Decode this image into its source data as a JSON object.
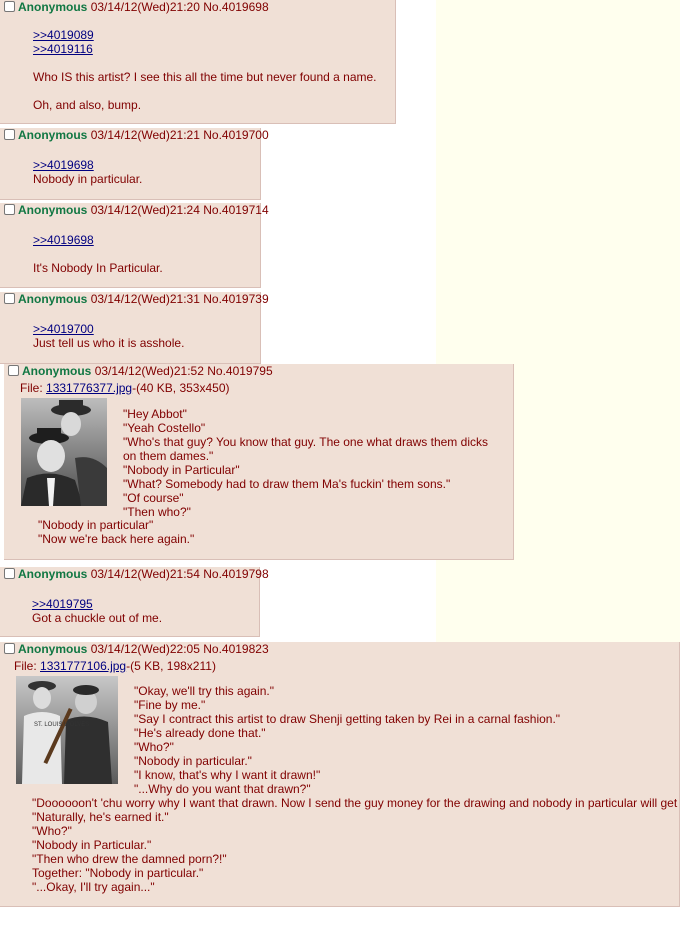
{
  "posts": [
    {
      "name": "Anonymous",
      "datetime": "03/14/12(Wed)21:20",
      "no": "No.4019698",
      "lines": [
        ">>4019089",
        ">>4019116",
        "",
        "Who IS this artist? I see this all the time but never found a name.",
        "",
        "Oh, and also, bump."
      ]
    },
    {
      "name": "Anonymous",
      "datetime": "03/14/12(Wed)21:21",
      "no": "No.4019700",
      "lines": [
        ">>4019698",
        "Nobody in particular."
      ]
    },
    {
      "name": "Anonymous",
      "datetime": "03/14/12(Wed)21:24",
      "no": "No.4019714",
      "lines": [
        ">>4019698",
        "",
        "It's Nobody In Particular."
      ]
    },
    {
      "name": "Anonymous",
      "datetime": "03/14/12(Wed)21:31",
      "no": "No.4019739",
      "lines": [
        ">>4019700",
        "Just tell us who it is asshole."
      ]
    },
    {
      "name": "Anonymous",
      "datetime": "03/14/12(Wed)21:52",
      "no": "No.4019795",
      "file_prefix": "File: ",
      "file_name": "1331776377.jpg",
      "file_meta": "-(40 KB, 353x450)",
      "lines": [
        "\"Hey Abbot\"",
        "\"Yeah Costello\"",
        "\"Who's that guy? You know that guy. The one what draws them dicks",
        "on them dames.\"",
        "\"Nobody in Particular\"",
        "\"What? Somebody had to draw them Ma's fuckin' them sons.\"",
        "\"Of course\"",
        "\"Then who?\""
      ],
      "lines_below": [
        "\"Nobody in particular\"",
        "\"Now we're back here again.\""
      ]
    },
    {
      "name": "Anonymous",
      "datetime": "03/14/12(Wed)21:54",
      "no": "No.4019798",
      "lines": [
        ">>4019795",
        "Got a chuckle out of me."
      ]
    },
    {
      "name": "Anonymous",
      "datetime": "03/14/12(Wed)22:05",
      "no": "No.4019823",
      "file_prefix": "File: ",
      "file_name": "1331777106.jpg",
      "file_meta": "-(5 KB, 198x211)",
      "lines": [
        "\"Okay, we'll try this again.\"",
        "\"Fine by me.\"",
        "\"Say I contract this artist to draw Shenji getting taken by Rei in a carnal fashion.\"",
        "\"He's already done that.\"",
        "\"Who?\"",
        "\"Nobody in particular.\"",
        "\"I know, that's why I want it drawn!\"",
        "\"...Why do you want that drawn?\""
      ],
      "lines_below": [
        "\"Doooooon't 'chu worry why I want that drawn. Now I send the guy money for the drawing and nobody in particular will get paid?\"",
        "\"Naturally, he's earned it.\"",
        "\"Who?\"",
        "\"Nobody in Particular.\"",
        "\"Then who drew the damned porn?!\"",
        "Together: \"Nobody in particular.\"",
        "\"...Okay, I'll try again...\""
      ],
      "thumb_text": "ST. LOUIS WOLVES"
    }
  ],
  "colors": {
    "background": "#ffffee",
    "post_bg": "#f0e0d6",
    "name": "#117743",
    "text": "#800000",
    "link": "#000080"
  }
}
